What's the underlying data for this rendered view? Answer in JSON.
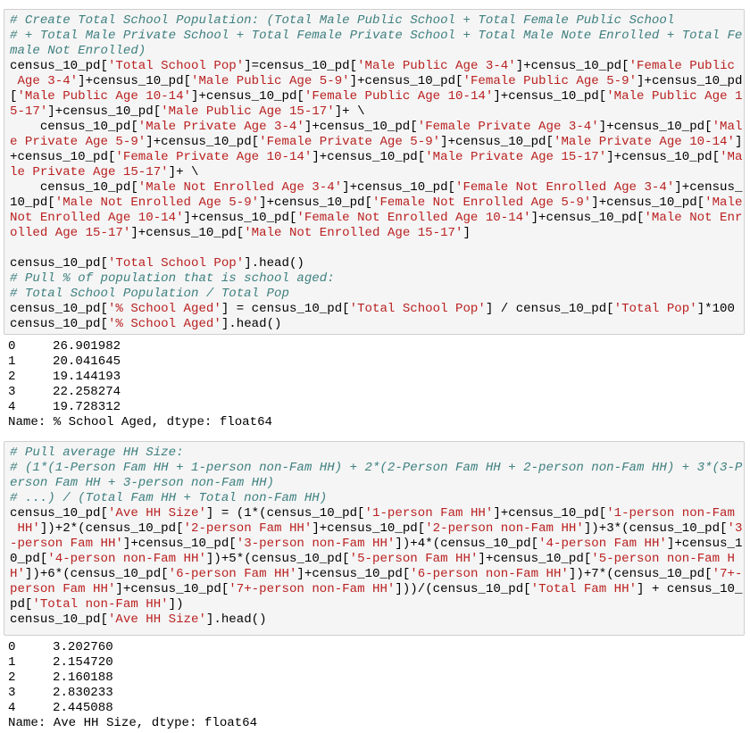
{
  "cells": [
    {
      "lines": [
        [
          {
            "t": "c",
            "v": "# Create Total School Population: (Total Male Public School + Total Female Public School"
          }
        ],
        [
          {
            "t": "c",
            "v": "# + Total Male Private School + Total Female Private School + Total Male Note Enrolled + Total Fe"
          }
        ],
        [
          {
            "t": "c",
            "v": "male Not Enrolled)"
          }
        ],
        [
          {
            "t": "n",
            "v": "census_10_pd["
          },
          {
            "t": "s",
            "v": "'Total School Pop'"
          },
          {
            "t": "n",
            "v": "]=census_10_pd["
          },
          {
            "t": "s",
            "v": "'Male Public Age 3-4'"
          },
          {
            "t": "n",
            "v": "]+census_10_pd["
          },
          {
            "t": "s",
            "v": "'Female Public"
          }
        ],
        [
          {
            "t": "s",
            "v": " Age 3-4'"
          },
          {
            "t": "n",
            "v": "]+census_10_pd["
          },
          {
            "t": "s",
            "v": "'Male Public Age 5-9'"
          },
          {
            "t": "n",
            "v": "]+census_10_pd["
          },
          {
            "t": "s",
            "v": "'Female Public Age 5-9'"
          },
          {
            "t": "n",
            "v": "]+census_10_pd"
          }
        ],
        [
          {
            "t": "n",
            "v": "["
          },
          {
            "t": "s",
            "v": "'Male Public Age 10-14'"
          },
          {
            "t": "n",
            "v": "]+census_10_pd["
          },
          {
            "t": "s",
            "v": "'Female Public Age 10-14'"
          },
          {
            "t": "n",
            "v": "]+census_10_pd["
          },
          {
            "t": "s",
            "v": "'Male Public Age 1"
          }
        ],
        [
          {
            "t": "s",
            "v": "5-17'"
          },
          {
            "t": "n",
            "v": "]+census_10_pd["
          },
          {
            "t": "s",
            "v": "'Male Public Age 15-17'"
          },
          {
            "t": "n",
            "v": "]+ \\"
          }
        ],
        [
          {
            "t": "n",
            "v": "    census_10_pd["
          },
          {
            "t": "s",
            "v": "'Male Private Age 3-4'"
          },
          {
            "t": "n",
            "v": "]+census_10_pd["
          },
          {
            "t": "s",
            "v": "'Female Private Age 3-4'"
          },
          {
            "t": "n",
            "v": "]+census_10_pd["
          },
          {
            "t": "s",
            "v": "'Mal"
          }
        ],
        [
          {
            "t": "s",
            "v": "e Private Age 5-9'"
          },
          {
            "t": "n",
            "v": "]+census_10_pd["
          },
          {
            "t": "s",
            "v": "'Female Private Age 5-9'"
          },
          {
            "t": "n",
            "v": "]+census_10_pd["
          },
          {
            "t": "s",
            "v": "'Male Private Age 10-14'"
          },
          {
            "t": "n",
            "v": "]"
          }
        ],
        [
          {
            "t": "n",
            "v": "+census_10_pd["
          },
          {
            "t": "s",
            "v": "'Female Private Age 10-14'"
          },
          {
            "t": "n",
            "v": "]+census_10_pd["
          },
          {
            "t": "s",
            "v": "'Male Private Age 15-17'"
          },
          {
            "t": "n",
            "v": "]+census_10_pd["
          },
          {
            "t": "s",
            "v": "'Ma"
          }
        ],
        [
          {
            "t": "s",
            "v": "le Private Age 15-17'"
          },
          {
            "t": "n",
            "v": "]+ \\"
          }
        ],
        [
          {
            "t": "n",
            "v": "    census_10_pd["
          },
          {
            "t": "s",
            "v": "'Male Not Enrolled Age 3-4'"
          },
          {
            "t": "n",
            "v": "]+census_10_pd["
          },
          {
            "t": "s",
            "v": "'Female Not Enrolled Age 3-4'"
          },
          {
            "t": "n",
            "v": "]+census_"
          }
        ],
        [
          {
            "t": "n",
            "v": "10_pd["
          },
          {
            "t": "s",
            "v": "'Male Not Enrolled Age 5-9'"
          },
          {
            "t": "n",
            "v": "]+census_10_pd["
          },
          {
            "t": "s",
            "v": "'Female Not Enrolled Age 5-9'"
          },
          {
            "t": "n",
            "v": "]+census_10_pd["
          },
          {
            "t": "s",
            "v": "'Male"
          }
        ],
        [
          {
            "t": "s",
            "v": "Not Enrolled Age 10-14'"
          },
          {
            "t": "n",
            "v": "]+census_10_pd["
          },
          {
            "t": "s",
            "v": "'Female Not Enrolled Age 10-14'"
          },
          {
            "t": "n",
            "v": "]+census_10_pd["
          },
          {
            "t": "s",
            "v": "'Male Not Enr"
          }
        ],
        [
          {
            "t": "s",
            "v": "olled Age 15-17'"
          },
          {
            "t": "n",
            "v": "]+census_10_pd["
          },
          {
            "t": "s",
            "v": "'Male Not Enrolled Age 15-17'"
          },
          {
            "t": "n",
            "v": "]"
          }
        ],
        [
          {
            "t": "n",
            "v": ""
          }
        ],
        [
          {
            "t": "n",
            "v": "census_10_pd["
          },
          {
            "t": "s",
            "v": "'Total School Pop'"
          },
          {
            "t": "n",
            "v": "].head()"
          }
        ],
        [
          {
            "t": "c",
            "v": "# Pull % of population that is school aged:"
          }
        ],
        [
          {
            "t": "c",
            "v": "# Total School Population / Total Pop"
          }
        ],
        [
          {
            "t": "n",
            "v": "census_10_pd["
          },
          {
            "t": "s",
            "v": "'% School Aged'"
          },
          {
            "t": "n",
            "v": "] = census_10_pd["
          },
          {
            "t": "s",
            "v": "'Total School Pop'"
          },
          {
            "t": "n",
            "v": "] / census_10_pd["
          },
          {
            "t": "s",
            "v": "'Total Pop'"
          },
          {
            "t": "n",
            "v": "]*100"
          }
        ],
        [
          {
            "t": "n",
            "v": "census_10_pd["
          },
          {
            "t": "s",
            "v": "'% School Aged'"
          },
          {
            "t": "n",
            "v": "].head()"
          }
        ]
      ],
      "output": {
        "rows": [
          {
            "index": "0",
            "value": "26.901982"
          },
          {
            "index": "1",
            "value": "20.041645"
          },
          {
            "index": "2",
            "value": "19.144193"
          },
          {
            "index": "3",
            "value": "22.258274"
          },
          {
            "index": "4",
            "value": "19.728312"
          }
        ],
        "footer": "Name: % School Aged, dtype: float64"
      }
    },
    {
      "lines": [
        [
          {
            "t": "c",
            "v": "# Pull average HH Size:"
          }
        ],
        [
          {
            "t": "c",
            "v": "# (1*(1-Person Fam HH + 1-person non-Fam HH) + 2*(2-Person Fam HH + 2-person non-Fam HH) + 3*(3-P"
          }
        ],
        [
          {
            "t": "c",
            "v": "erson Fam HH + 3-person non-Fam HH)"
          }
        ],
        [
          {
            "t": "c",
            "v": "# ...) / (Total Fam HH + Total non-Fam HH)"
          }
        ],
        [
          {
            "t": "n",
            "v": "census_10_pd["
          },
          {
            "t": "s",
            "v": "'Ave HH Size'"
          },
          {
            "t": "n",
            "v": "] = (1*(census_10_pd["
          },
          {
            "t": "s",
            "v": "'1-person Fam HH'"
          },
          {
            "t": "n",
            "v": "]+census_10_pd["
          },
          {
            "t": "s",
            "v": "'1-person non-Fam"
          }
        ],
        [
          {
            "t": "s",
            "v": " HH'"
          },
          {
            "t": "n",
            "v": "])+2*(census_10_pd["
          },
          {
            "t": "s",
            "v": "'2-person Fam HH'"
          },
          {
            "t": "n",
            "v": "]+census_10_pd["
          },
          {
            "t": "s",
            "v": "'2-person non-Fam HH'"
          },
          {
            "t": "n",
            "v": "])+3*(census_10_pd["
          },
          {
            "t": "s",
            "v": "'3"
          }
        ],
        [
          {
            "t": "s",
            "v": "-person Fam HH'"
          },
          {
            "t": "n",
            "v": "]+census_10_pd["
          },
          {
            "t": "s",
            "v": "'3-person non-Fam HH'"
          },
          {
            "t": "n",
            "v": "])+4*(census_10_pd["
          },
          {
            "t": "s",
            "v": "'4-person Fam HH'"
          },
          {
            "t": "n",
            "v": "]+census_1"
          }
        ],
        [
          {
            "t": "n",
            "v": "0_pd["
          },
          {
            "t": "s",
            "v": "'4-person non-Fam HH'"
          },
          {
            "t": "n",
            "v": "])+5*(census_10_pd["
          },
          {
            "t": "s",
            "v": "'5-person Fam HH'"
          },
          {
            "t": "n",
            "v": "]+census_10_pd["
          },
          {
            "t": "s",
            "v": "'5-person non-Fam H"
          }
        ],
        [
          {
            "t": "s",
            "v": "H'"
          },
          {
            "t": "n",
            "v": "])+6*(census_10_pd["
          },
          {
            "t": "s",
            "v": "'6-person Fam HH'"
          },
          {
            "t": "n",
            "v": "]+census_10_pd["
          },
          {
            "t": "s",
            "v": "'6-person non-Fam HH'"
          },
          {
            "t": "n",
            "v": "])+7*(census_10_pd["
          },
          {
            "t": "s",
            "v": "'7+-"
          }
        ],
        [
          {
            "t": "s",
            "v": "person Fam HH'"
          },
          {
            "t": "n",
            "v": "]+census_10_pd["
          },
          {
            "t": "s",
            "v": "'7+-person non-Fam HH'"
          },
          {
            "t": "n",
            "v": "]))/(census_10_pd["
          },
          {
            "t": "s",
            "v": "'Total Fam HH'"
          },
          {
            "t": "n",
            "v": "] + census_10_"
          }
        ],
        [
          {
            "t": "n",
            "v": "pd["
          },
          {
            "t": "s",
            "v": "'Total non-Fam HH'"
          },
          {
            "t": "n",
            "v": "])"
          }
        ],
        [
          {
            "t": "n",
            "v": "census_10_pd["
          },
          {
            "t": "s",
            "v": "'Ave HH Size'"
          },
          {
            "t": "n",
            "v": "].head()"
          }
        ]
      ],
      "output": {
        "rows": [
          {
            "index": "0",
            "value": "3.202760"
          },
          {
            "index": "1",
            "value": "2.154720"
          },
          {
            "index": "2",
            "value": "2.160188"
          },
          {
            "index": "3",
            "value": "2.830233"
          },
          {
            "index": "4",
            "value": "2.445088"
          }
        ],
        "footer": "Name: Ave HH Size, dtype: float64"
      }
    }
  ],
  "colors": {
    "comment": "#408080",
    "string": "#ba2121",
    "code": "#000000",
    "cell_background": "#f5f5f5",
    "cell_border": "#cfcfcf"
  }
}
